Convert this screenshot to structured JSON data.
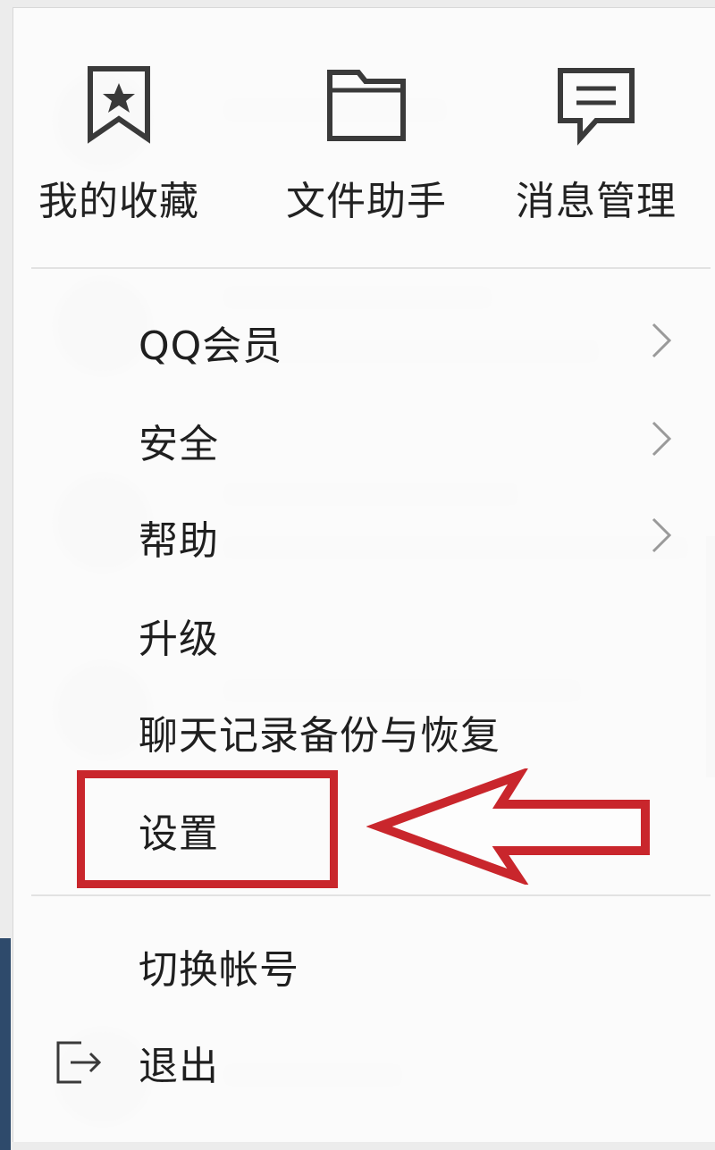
{
  "quick_actions": [
    {
      "label": "我的收藏",
      "icon": "bookmark-star-icon"
    },
    {
      "label": "文件助手",
      "icon": "folder-icon"
    },
    {
      "label": "消息管理",
      "icon": "message-icon"
    }
  ],
  "menu_items": [
    {
      "label": "QQ会员",
      "has_submenu": true
    },
    {
      "label": "安全",
      "has_submenu": true
    },
    {
      "label": "帮助",
      "has_submenu": true
    },
    {
      "label": "升级",
      "has_submenu": false
    },
    {
      "label": "聊天记录备份与恢复",
      "has_submenu": false
    },
    {
      "label": "设置",
      "has_submenu": false,
      "highlighted": true
    }
  ],
  "footer_items": [
    {
      "label": "切换帐号"
    },
    {
      "label": "退出",
      "icon": "exit-icon"
    }
  ],
  "colors": {
    "annotation_red": "#c9262c",
    "text": "#1f1f1f",
    "icon": "#3a3a3a",
    "chevron": "#9a9a9a"
  }
}
